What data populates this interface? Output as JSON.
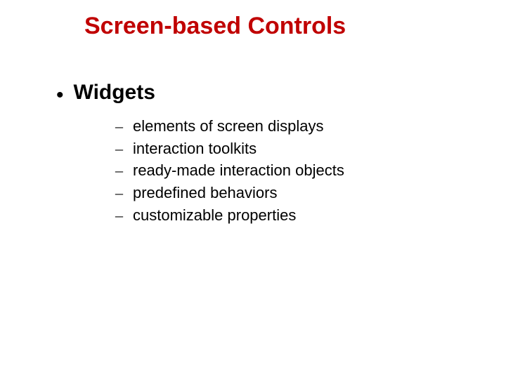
{
  "slide": {
    "title": "Screen-based Controls",
    "bullets": [
      {
        "label": "Widgets",
        "sub": [
          "elements of screen displays",
          "interaction toolkits",
          "ready-made interaction objects",
          "predefined behaviors",
          "customizable properties"
        ]
      }
    ]
  }
}
